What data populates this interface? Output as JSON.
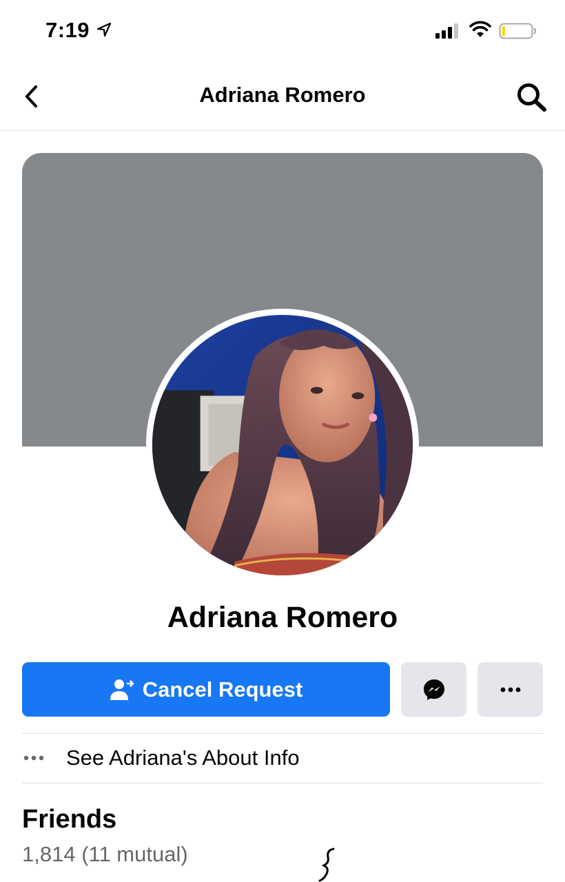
{
  "status_bar": {
    "time": "7:19",
    "icons": [
      "location-arrow-icon",
      "signal-icon",
      "wifi-icon",
      "battery-icon"
    ]
  },
  "header": {
    "title": "Adriana Romero",
    "back_icon": "chevron-left-icon",
    "search_icon": "search-icon"
  },
  "profile": {
    "name": "Adriana Romero",
    "cover_color": "#86898c"
  },
  "actions": {
    "cancel_request_label": "Cancel Request",
    "cancel_request_icon": "person-arrow-icon",
    "messenger_icon": "messenger-icon",
    "more_icon": "more-dots-icon",
    "primary_color": "#1877f2"
  },
  "about": {
    "label": "See Adriana's About Info",
    "icon": "more-dots-icon"
  },
  "friends": {
    "heading": "Friends",
    "count": "1,814 (11 mutual)"
  }
}
